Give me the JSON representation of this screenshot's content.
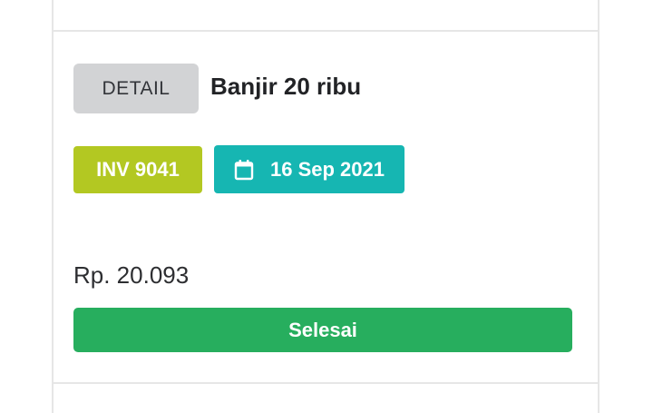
{
  "card": {
    "detail_button": "DETAIL",
    "title": "Banjir 20 ribu",
    "invoice": "INV 9041",
    "date": "16 Sep 2021",
    "price": "Rp. 20.093",
    "done_button": "Selesai"
  },
  "icons": {
    "date": "calendar-icon"
  },
  "colors": {
    "detail_bg": "#d2d3d5",
    "invoice_bg": "#b3c822",
    "date_bg": "#16b6b2",
    "done_bg": "#27ae5e"
  }
}
